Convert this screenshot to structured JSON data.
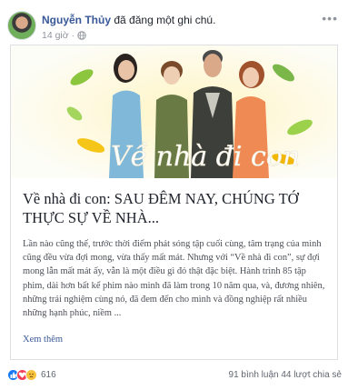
{
  "post": {
    "author": "Nguyễn Thủy",
    "action": "đã đăng một ghi chú.",
    "time": "14 giờ",
    "separator": "·"
  },
  "note": {
    "cover_script": "Về nhà đi con",
    "title": "Về nhà đi con: SAU ĐÊM NAY, CHÚNG TỚ THỰC SỰ VỀ NHÀ...",
    "excerpt": "Lần nào cũng thế, trước thời điểm phát sóng tập cuối cùng, tâm trạng của mình cũng đều vừa đợi mong, vừa thấy mất mát. Nhưng với “Về nhà đi con”, sự đợi mong lẫn mất mát ấy, vẫn là một điều gì đó thật đặc biệt. Hành trình 85 tập phim, dài hơn bất kể phim nào mình đã làm trong 10 năm qua, và, đương nhiên, những trải nghiệm cùng nó, đã đem đến cho mình và đồng nghiệp rất nhiều những hạnh phúc, niềm ...",
    "see_more": "Xem thêm"
  },
  "footer": {
    "reaction_icons": [
      "like-icon",
      "love-icon",
      "sad-icon"
    ],
    "reaction_count": "616",
    "comments": "91 bình luận",
    "shares": "44 lượt chia sẻ"
  },
  "colors": {
    "link": "#385898",
    "meta": "#90949c",
    "like": "#1877f2",
    "love": "#f33e58",
    "sad": "#f7c23c"
  }
}
